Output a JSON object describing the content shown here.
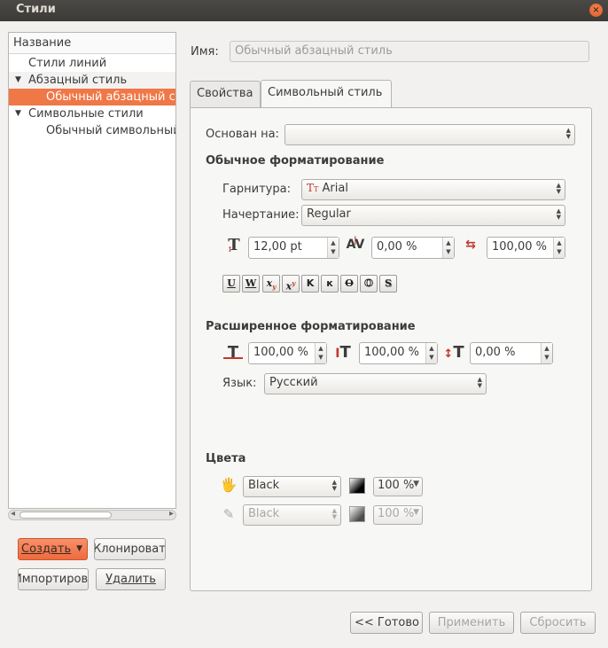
{
  "window": {
    "title": "Стили"
  },
  "tree": {
    "header": "Название",
    "rows": [
      {
        "label": "Стили линий"
      },
      {
        "label": "Абзацный стиль"
      },
      {
        "label": "Обычный абзацный стиль"
      },
      {
        "label": "Символьные стили"
      },
      {
        "label": "Обычный символьный стиль"
      }
    ]
  },
  "left_buttons": {
    "create": "Создать",
    "clone": "Клонировать",
    "import": "Импортировать",
    "delete": "Удалить"
  },
  "name_field": {
    "label": "Имя:",
    "value": "Обычный абзацный стиль"
  },
  "tabs": [
    {
      "label": "Свойства"
    },
    {
      "label": "Символьный стиль"
    }
  ],
  "based_on": {
    "label": "Основан на:",
    "value": ""
  },
  "basic_formatting": {
    "title": "Обычное форматирование",
    "font_family_label": "Гарнитура:",
    "font_family_value": "Arial",
    "font_style_label": "Начертание:",
    "font_style_value": "Regular",
    "font_size": "12,00 pt",
    "tracking": "0,00 %",
    "horizontal_scale": "100,00 %",
    "effects": [
      "U",
      "W",
      "x",
      "x",
      "K",
      "к",
      "O",
      "O",
      "S"
    ]
  },
  "advanced_formatting": {
    "title": "Расширенное форматирование",
    "vertical_scale": "100,00 %",
    "scale_2": "100,00 %",
    "baseline_offset": "0,00 %",
    "language_label": "Язык:",
    "language_value": "Русский"
  },
  "colors": {
    "title": "Цвета",
    "fill_color": "Black",
    "fill_shade": "100 %",
    "stroke_color": "Black",
    "stroke_shade": "100 %"
  },
  "bottom_buttons": {
    "done": "<< Готово",
    "apply": "Применить",
    "reset": "Сбросить"
  }
}
